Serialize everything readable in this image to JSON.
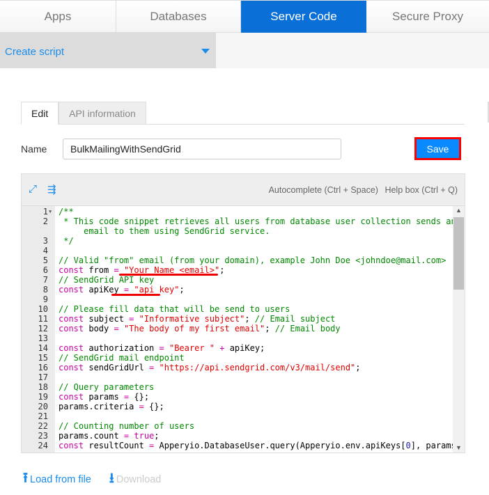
{
  "top_tabs": [
    {
      "label": "Apps"
    },
    {
      "label": "Databases"
    },
    {
      "label": "Server Code",
      "active": true
    },
    {
      "label": "Secure Proxy"
    }
  ],
  "script_dropdown": {
    "value": "Create script"
  },
  "sub_tabs": [
    {
      "label": "Edit",
      "active": true
    },
    {
      "label": "API information"
    }
  ],
  "name_field": {
    "label": "Name",
    "value": "BulkMailingWithSendGrid"
  },
  "save_label": "Save",
  "editor_toolbar": {
    "icons": [
      "expand-icon",
      "format-indent-icon"
    ],
    "autocomplete": "Autocomplete (Ctrl + Space)",
    "helpbox": "Help box (Ctrl + Q)"
  },
  "colors": {
    "accent": "#0a6fd6",
    "save": "#0a8aff",
    "annotation": "#ee0000",
    "comment": "#008800",
    "keyword": "#c800a4",
    "string": "#e00000"
  },
  "code_lines": [
    {
      "n": "1",
      "fold": true,
      "t": [
        [
          "cm",
          "/**"
        ]
      ]
    },
    {
      "n": "2",
      "t": [
        [
          "cm",
          " * This code snippet retrieves all users from database user collection sends an"
        ]
      ]
    },
    {
      "n": "",
      "t": [
        [
          "cm",
          "     email to them using SendGrid service."
        ]
      ]
    },
    {
      "n": "3",
      "t": [
        [
          "cm",
          " */"
        ]
      ]
    },
    {
      "n": "4",
      "t": []
    },
    {
      "n": "5",
      "t": [
        [
          "cm",
          "// Valid \"from\" email (from your domain), example John Doe <johndoe@mail.com>"
        ]
      ]
    },
    {
      "n": "6",
      "t": [
        [
          "kw",
          "const"
        ],
        [
          "pl",
          " from "
        ],
        [
          "op",
          "="
        ],
        [
          "pl",
          " "
        ],
        [
          "str",
          "\"Your Name <email>\""
        ],
        [
          "pl",
          ";"
        ]
      ]
    },
    {
      "n": "7",
      "t": [
        [
          "cm",
          "// SendGrid API key"
        ]
      ]
    },
    {
      "n": "8",
      "t": [
        [
          "kw",
          "const"
        ],
        [
          "pl",
          " apiKey "
        ],
        [
          "op",
          "="
        ],
        [
          "pl",
          " "
        ],
        [
          "str",
          "\"api_key\""
        ],
        [
          "pl",
          ";"
        ]
      ]
    },
    {
      "n": "9",
      "t": []
    },
    {
      "n": "10",
      "t": [
        [
          "cm",
          "// Please fill data that will be send to users"
        ]
      ]
    },
    {
      "n": "11",
      "t": [
        [
          "kw",
          "const"
        ],
        [
          "pl",
          " subject "
        ],
        [
          "op",
          "="
        ],
        [
          "pl",
          " "
        ],
        [
          "str",
          "\"Informative subject\""
        ],
        [
          "pl",
          "; "
        ],
        [
          "cm",
          "// Email subject"
        ]
      ]
    },
    {
      "n": "12",
      "t": [
        [
          "kw",
          "const"
        ],
        [
          "pl",
          " body "
        ],
        [
          "op",
          "="
        ],
        [
          "pl",
          " "
        ],
        [
          "str",
          "\"The body of my first email\""
        ],
        [
          "pl",
          "; "
        ],
        [
          "cm",
          "// Email body"
        ]
      ]
    },
    {
      "n": "13",
      "t": []
    },
    {
      "n": "14",
      "t": [
        [
          "kw",
          "const"
        ],
        [
          "pl",
          " authorization "
        ],
        [
          "op",
          "="
        ],
        [
          "pl",
          " "
        ],
        [
          "str",
          "\"Bearer \""
        ],
        [
          "pl",
          " "
        ],
        [
          "op",
          "+"
        ],
        [
          "pl",
          " apiKey;"
        ]
      ]
    },
    {
      "n": "15",
      "t": [
        [
          "cm",
          "// SendGrid mail endpoint"
        ]
      ]
    },
    {
      "n": "16",
      "t": [
        [
          "kw",
          "const"
        ],
        [
          "pl",
          " sendGridUrl "
        ],
        [
          "op",
          "="
        ],
        [
          "pl",
          " "
        ],
        [
          "str",
          "\"https://api.sendgrid.com/v3/mail/send\""
        ],
        [
          "pl",
          ";"
        ]
      ]
    },
    {
      "n": "17",
      "t": []
    },
    {
      "n": "18",
      "t": [
        [
          "cm",
          "// Query parameters"
        ]
      ]
    },
    {
      "n": "19",
      "t": [
        [
          "kw",
          "const"
        ],
        [
          "pl",
          " params "
        ],
        [
          "op",
          "="
        ],
        [
          "pl",
          " {};"
        ]
      ]
    },
    {
      "n": "20",
      "t": [
        [
          "pl",
          "params.criteria "
        ],
        [
          "op",
          "="
        ],
        [
          "pl",
          " {};"
        ]
      ]
    },
    {
      "n": "21",
      "t": []
    },
    {
      "n": "22",
      "t": [
        [
          "cm",
          "// Counting number of users"
        ]
      ]
    },
    {
      "n": "23",
      "t": [
        [
          "pl",
          "params.count "
        ],
        [
          "op",
          "="
        ],
        [
          "pl",
          " "
        ],
        [
          "kw",
          "true"
        ],
        [
          "pl",
          ";"
        ]
      ]
    },
    {
      "n": "24",
      "t": [
        [
          "kw",
          "const"
        ],
        [
          "pl",
          " resultCount "
        ],
        [
          "op",
          "="
        ],
        [
          "pl",
          " Apperyio.DatabaseUser.query(Apperyio.env.apiKeys["
        ],
        [
          "num",
          "0"
        ],
        [
          "pl",
          "], params,"
        ]
      ]
    }
  ],
  "footer_links": {
    "load": "Load from file",
    "download": "Download"
  }
}
